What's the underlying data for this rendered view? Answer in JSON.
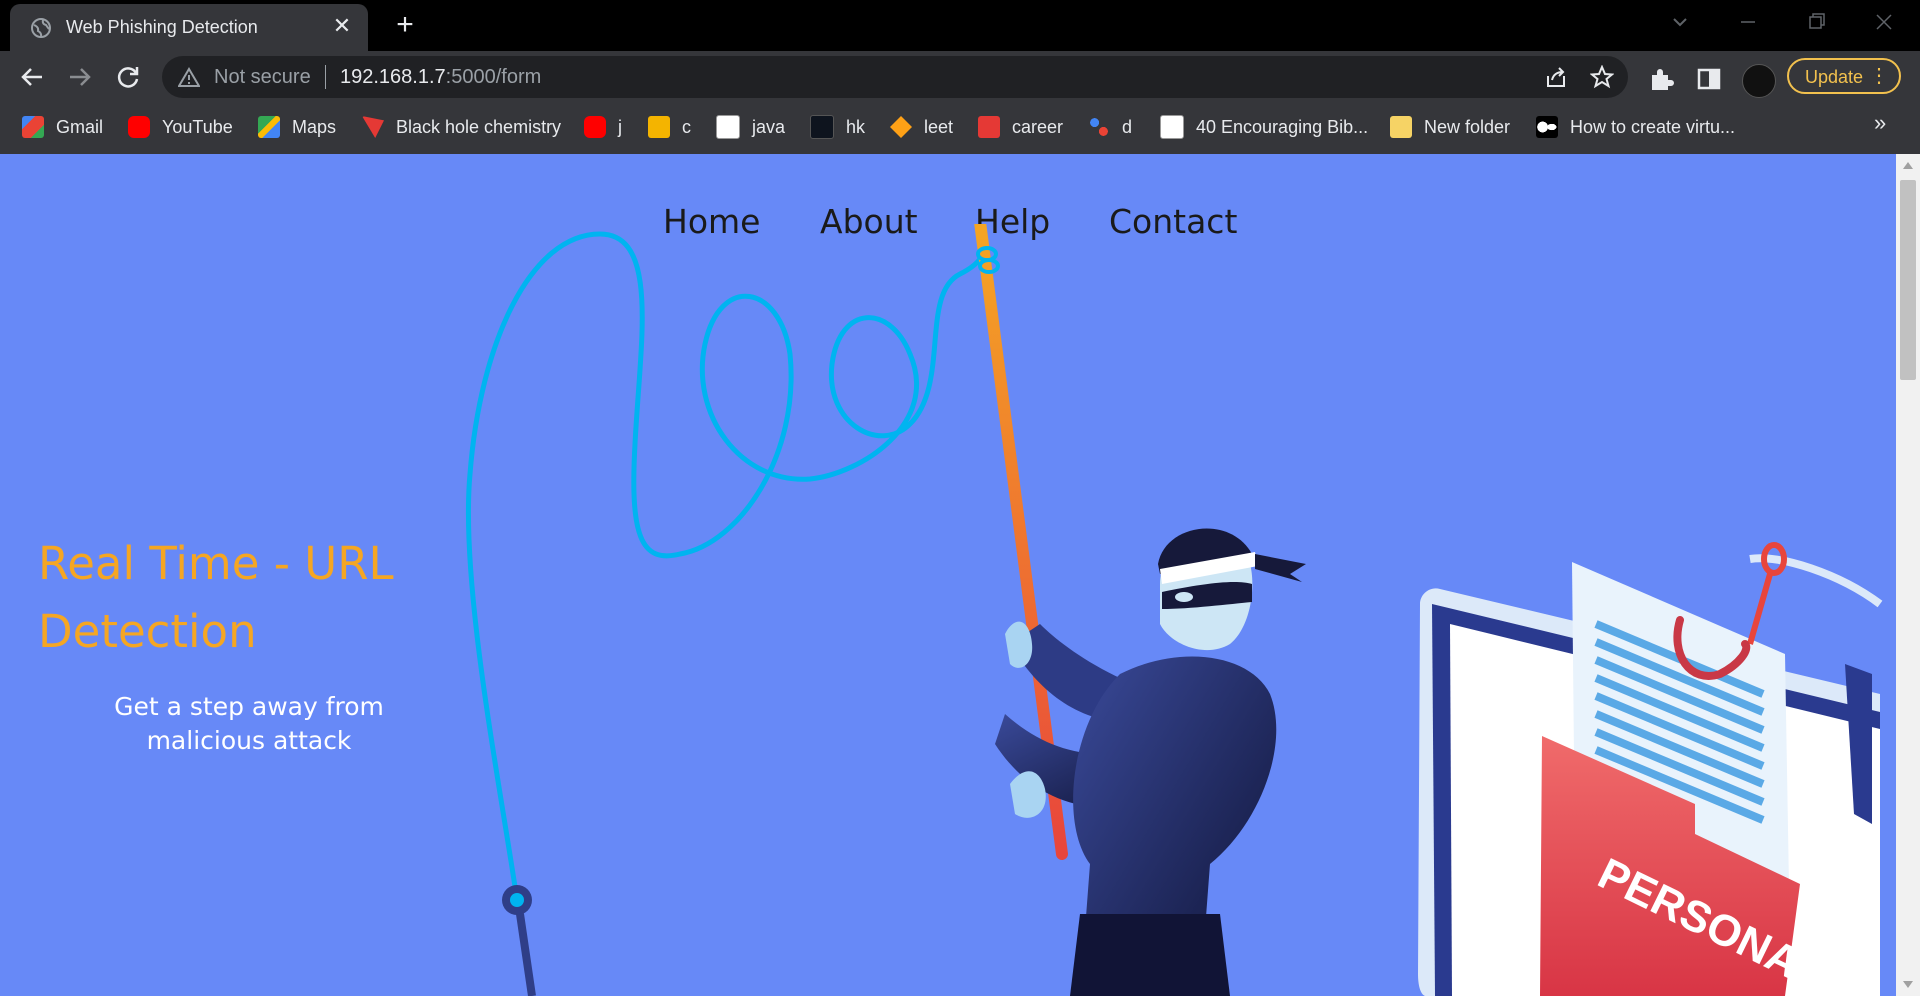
{
  "browser": {
    "tab_title": "Web Phishing Detection",
    "not_secure": "Not secure",
    "url_host": "192.168.1.7",
    "url_path": ":5000/form",
    "update_label": "Update"
  },
  "bookmarks": [
    {
      "label": "Gmail",
      "icon": "gmail-icon",
      "color": "#ea4335"
    },
    {
      "label": "YouTube",
      "icon": "youtube-icon",
      "color": "#ff0000"
    },
    {
      "label": "Maps",
      "icon": "maps-icon",
      "color": "#34a853"
    },
    {
      "label": "Black hole chemistry",
      "icon": "bookmark-favicon",
      "color": "#e53935"
    },
    {
      "label": "j",
      "icon": "youtube-icon",
      "color": "#ff0000"
    },
    {
      "label": "c",
      "icon": "classroom-icon",
      "color": "#f4b400"
    },
    {
      "label": "java",
      "icon": "w3schools-icon",
      "color": "#ffffff"
    },
    {
      "label": "hk",
      "icon": "hackerrank-icon",
      "color": "#0e141e"
    },
    {
      "label": "leet",
      "icon": "leetcode-icon",
      "color": "#ffa116"
    },
    {
      "label": "career",
      "icon": "careercup-icon",
      "color": "#e53935"
    },
    {
      "label": "d",
      "icon": "dots-icon",
      "color": "#4285f4"
    },
    {
      "label": "40 Encouraging Bib...",
      "icon": "building-icon",
      "color": "#ffffff"
    },
    {
      "label": "New folder",
      "icon": "folder-icon",
      "color": "#f6d365"
    },
    {
      "label": "How to create virtu...",
      "icon": "medium-icon",
      "color": "#ffffff"
    }
  ],
  "site": {
    "nav": [
      "Home",
      "About",
      "Help",
      "Contact"
    ],
    "hero_title": "Real Time - URL Detection",
    "hero_subtitle": "Get a step away from malicious attack",
    "folder_label": "PERSONAL"
  },
  "colors": {
    "page_bg": "#6789f7",
    "accent": "#f5a623",
    "update_border": "#f2c14e"
  }
}
